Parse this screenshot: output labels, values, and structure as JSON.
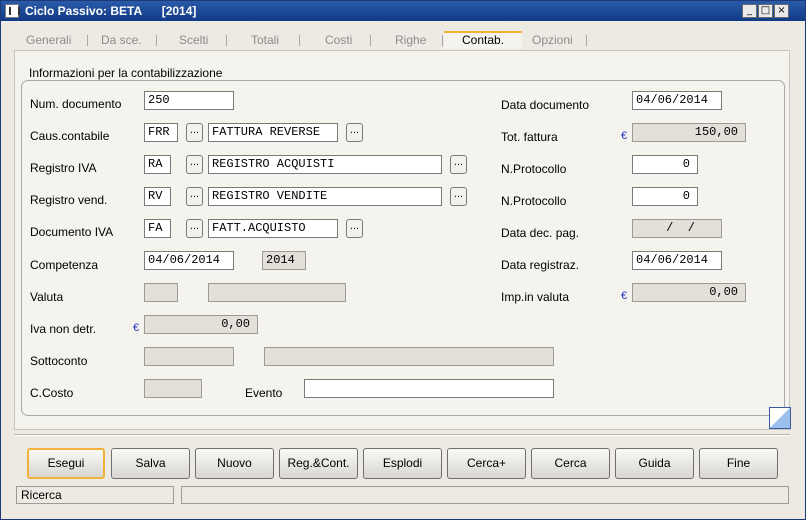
{
  "window": {
    "title": "Ciclo Passivo: BETA      [2014]"
  },
  "window_controls": {
    "minimize": "_",
    "maximize": "□",
    "close": "×"
  },
  "tabs": [
    "Generali",
    "Da sce.",
    "Scelti",
    "Totali",
    "Costi",
    "Righe",
    "Contab.",
    "Opzioni"
  ],
  "active_tab": "Contab.",
  "group_title": "Informazioni per la contabilizzazione",
  "ellipsis": "...",
  "currency_symbol": "€",
  "form": {
    "num_documento": {
      "label": "Num. documento",
      "value": "250"
    },
    "caus_contabile": {
      "label": "Caus.contabile",
      "code": "FRR",
      "desc": "FATTURA REVERSE"
    },
    "registro_iva": {
      "label": "Registro IVA",
      "code": "RA",
      "desc": "REGISTRO ACQUISTI"
    },
    "registro_vend": {
      "label": "Registro vend.",
      "code": "RV",
      "desc": "REGISTRO VENDITE"
    },
    "documento_iva": {
      "label": "Documento IVA",
      "code": "FA",
      "desc": "FATT.ACQUISTO"
    },
    "competenza": {
      "label": "Competenza",
      "date": "04/06/2014",
      "year": "2014"
    },
    "valuta": {
      "label": "Valuta",
      "code": "",
      "desc": ""
    },
    "iva_non_detr": {
      "label": "Iva non detr.",
      "value": "0,00"
    },
    "sottoconto": {
      "label": "Sottoconto",
      "code": "",
      "desc": ""
    },
    "c_costo": {
      "label": "C.Costo",
      "value": ""
    },
    "evento": {
      "label": "Evento",
      "value": ""
    },
    "data_documento": {
      "label": "Data documento",
      "value": "04/06/2014"
    },
    "tot_fattura": {
      "label": "Tot. fattura",
      "value": "150,00"
    },
    "n_protocollo_1": {
      "label": "N.Protocollo",
      "value": "0"
    },
    "n_protocollo_2": {
      "label": "N.Protocollo",
      "value": "0"
    },
    "data_dec_pag": {
      "label": "Data dec. pag.",
      "value": " /  /"
    },
    "data_registraz": {
      "label": "Data registraz.",
      "value": "04/06/2014"
    },
    "imp_in_valuta": {
      "label": "Imp.in valuta",
      "value": "0,00"
    }
  },
  "buttons": [
    "Esegui",
    "Salva",
    "Nuovo",
    "Reg.&Cont.",
    "Esplodi",
    "Cerca+",
    "Cerca",
    "Guida",
    "Fine"
  ],
  "status": {
    "left": "Ricerca",
    "right": ""
  }
}
